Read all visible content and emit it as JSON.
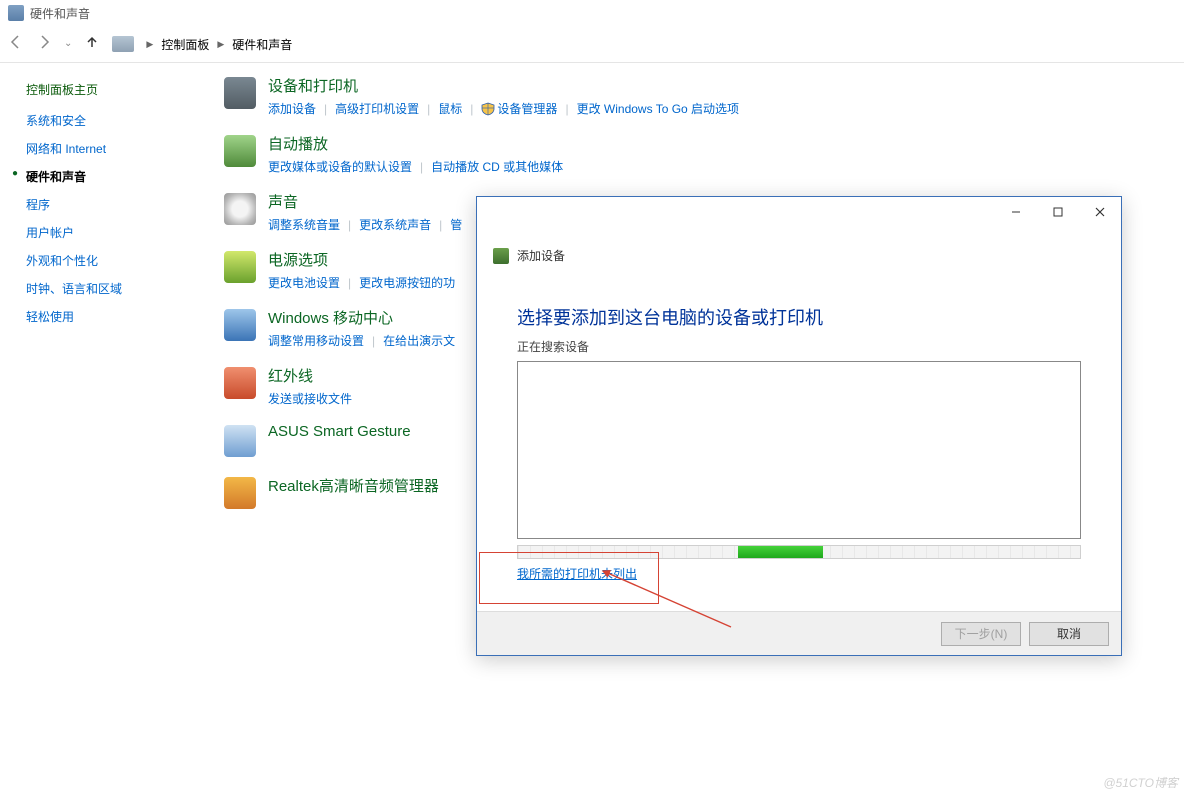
{
  "titlebar": {
    "title": "硬件和声音"
  },
  "breadcrumb": {
    "root": "控制面板",
    "current": "硬件和声音"
  },
  "sidebar": {
    "heading": "控制面板主页",
    "items": [
      {
        "label": "系统和安全"
      },
      {
        "label": "网络和 Internet"
      },
      {
        "label": "硬件和声音",
        "current": true
      },
      {
        "label": "程序"
      },
      {
        "label": "用户帐户"
      },
      {
        "label": "外观和个性化"
      },
      {
        "label": "时钟、语言和区域"
      },
      {
        "label": "轻松使用"
      }
    ]
  },
  "categories": [
    {
      "title": "设备和打印机",
      "icon_color": "linear-gradient(#7a8892,#525c63)",
      "links": [
        "添加设备",
        "高级打印机设置",
        "鼠标",
        "设备管理器",
        "更改 Windows To Go 启动选项"
      ],
      "shield_indices": [
        3
      ]
    },
    {
      "title": "自动播放",
      "icon_color": "linear-gradient(#a0d48a,#4f8a3a)",
      "links": [
        "更改媒体或设备的默认设置",
        "自动播放 CD 或其他媒体"
      ]
    },
    {
      "title": "声音",
      "icon_color": "radial-gradient(circle,#f4f4f4 35%,#b8b8b8 70%,#949494)",
      "links": [
        "调整系统音量",
        "更改系统声音",
        "管"
      ]
    },
    {
      "title": "电源选项",
      "icon_color": "linear-gradient(#d2e86c,#6aa12d)",
      "links": [
        "更改电池设置",
        "更改电源按钮的功"
      ]
    },
    {
      "title": "Windows 移动中心",
      "icon_color": "linear-gradient(#9ec6ea,#3b74b6)",
      "links": [
        "调整常用移动设置",
        "在给出演示文"
      ]
    },
    {
      "title": "红外线",
      "icon_color": "linear-gradient(#f08f6f,#c84b2b)",
      "links": [
        "发送或接收文件"
      ]
    },
    {
      "title": "ASUS Smart Gesture",
      "icon_color": "linear-gradient(#cfe2f3,#6f9ed1)",
      "links": []
    },
    {
      "title": "Realtek高清晰音频管理器",
      "icon_color": "linear-gradient(#f3b847,#d3792a)",
      "links": []
    }
  ],
  "dialog": {
    "head_title": "添加设备",
    "instruction": "选择要添加到这台电脑的设备或打印机",
    "searching": "正在搜索设备",
    "not_listed": "我所需的打印机未列出",
    "next": "下一步(N)",
    "cancel": "取消"
  },
  "watermark": "@51CTO博客"
}
